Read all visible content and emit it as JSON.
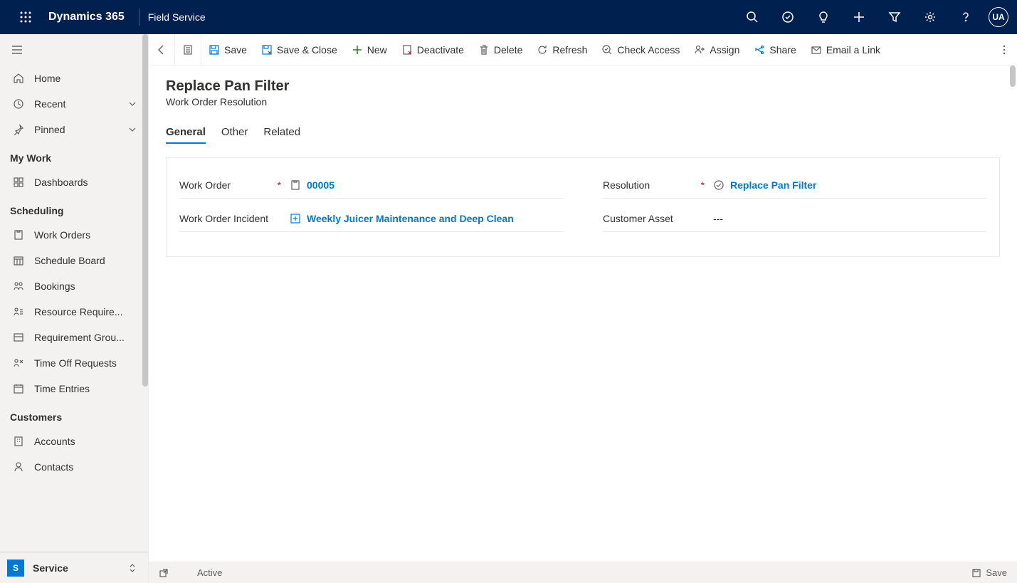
{
  "header": {
    "brand": "Dynamics 365",
    "app_name": "Field Service",
    "avatar_initials": "UA"
  },
  "sidebar": {
    "top_items": {
      "home": "Home",
      "recent": "Recent",
      "pinned": "Pinned"
    },
    "sections": [
      {
        "title": "My Work",
        "items": [
          {
            "label": "Dashboards"
          }
        ]
      },
      {
        "title": "Scheduling",
        "items": [
          {
            "label": "Work Orders"
          },
          {
            "label": "Schedule Board"
          },
          {
            "label": "Bookings"
          },
          {
            "label": "Resource Require..."
          },
          {
            "label": "Requirement Grou..."
          },
          {
            "label": "Time Off Requests"
          },
          {
            "label": "Time Entries"
          }
        ]
      },
      {
        "title": "Customers",
        "items": [
          {
            "label": "Accounts"
          },
          {
            "label": "Contacts"
          }
        ]
      }
    ],
    "area": {
      "badge": "S",
      "label": "Service"
    }
  },
  "command_bar": {
    "save": "Save",
    "save_close": "Save & Close",
    "new": "New",
    "deactivate": "Deactivate",
    "delete": "Delete",
    "refresh": "Refresh",
    "check_access": "Check Access",
    "assign": "Assign",
    "share": "Share",
    "email_link": "Email a Link"
  },
  "page": {
    "title": "Replace Pan Filter",
    "subtitle": "Work Order Resolution",
    "tabs": {
      "general": "General",
      "other": "Other",
      "related": "Related"
    },
    "fields": {
      "work_order": {
        "label": "Work Order",
        "value": "00005"
      },
      "work_order_incident": {
        "label": "Work Order Incident",
        "value": "Weekly Juicer Maintenance and Deep Clean"
      },
      "resolution": {
        "label": "Resolution",
        "value": "Replace Pan Filter"
      },
      "customer_asset": {
        "label": "Customer Asset",
        "value": "---"
      }
    }
  },
  "status_bar": {
    "status": "Active",
    "save": "Save"
  }
}
